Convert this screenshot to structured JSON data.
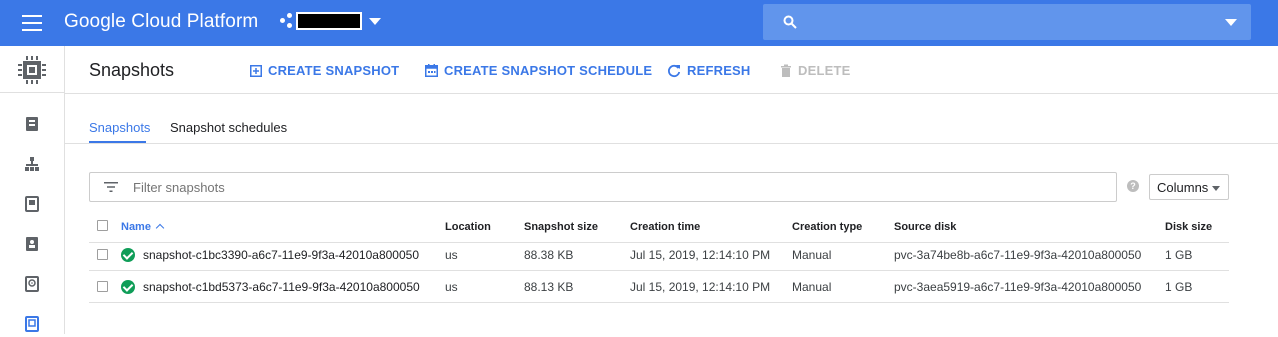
{
  "topbar": {
    "brand": "Google Cloud Platform",
    "search_placeholder": ""
  },
  "header": {
    "title": "Snapshots",
    "actions": {
      "create_snapshot": "CREATE SNAPSHOT",
      "create_schedule": "CREATE SNAPSHOT SCHEDULE",
      "refresh": "REFRESH",
      "delete": "DELETE"
    }
  },
  "tabs": {
    "snapshots": "Snapshots",
    "schedules": "Snapshot schedules"
  },
  "filter": {
    "placeholder": "Filter snapshots",
    "columns_label": "Columns"
  },
  "table": {
    "headers": {
      "name": "Name",
      "location": "Location",
      "snapshot_size": "Snapshot size",
      "creation_time": "Creation time",
      "creation_type": "Creation type",
      "source_disk": "Source disk",
      "disk_size": "Disk size"
    },
    "rows": [
      {
        "name": "snapshot-c1bc3390-a6c7-11e9-9f3a-42010a800050",
        "location": "us",
        "snapshot_size": "88.38 KB",
        "creation_time": "Jul 15, 2019, 12:14:10 PM",
        "creation_type": "Manual",
        "source_disk": "pvc-3a74be8b-a6c7-11e9-9f3a-42010a800050",
        "disk_size": "1 GB"
      },
      {
        "name": "snapshot-c1bd5373-a6c7-11e9-9f3a-42010a800050",
        "location": "us",
        "snapshot_size": "88.13 KB",
        "creation_time": "Jul 15, 2019, 12:14:10 PM",
        "creation_type": "Manual",
        "source_disk": "pvc-3aea5919-a6c7-11e9-9f3a-42010a800050",
        "disk_size": "1 GB"
      }
    ]
  },
  "colors": {
    "accent": "#3b78e7",
    "topbar": "#3b78e7",
    "status_ok": "#0f9d58",
    "disabled": "#bdbdbd"
  },
  "icons": {
    "menu": "hamburger-icon",
    "project": "project-icon",
    "search": "search-icon",
    "product": "compute-engine-chip-icon",
    "create_snapshot": "add-box-icon",
    "create_schedule": "calendar-icon",
    "refresh": "refresh-icon",
    "delete": "trash-icon",
    "filter": "filter-list-icon",
    "help": "help-icon",
    "status": "check-circle-icon"
  }
}
